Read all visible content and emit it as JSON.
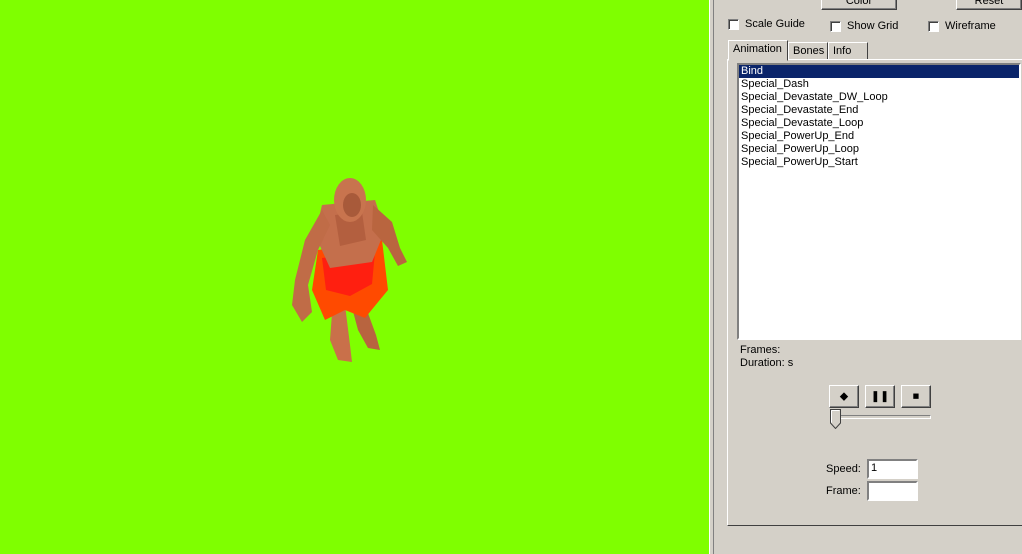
{
  "toolbar": {
    "color_button": "Color",
    "reset_button": "Reset",
    "scale_guide": "Scale Guide",
    "show_grid": "Show Grid",
    "wireframe": "Wireframe"
  },
  "tabs": [
    "Animation",
    "Bones",
    "Info"
  ],
  "animations": [
    "Bind",
    "Special_Dash",
    "Special_Devastate_DW_Loop",
    "Special_Devastate_End",
    "Special_Devastate_Loop",
    "Special_PowerUp_End",
    "Special_PowerUp_Loop",
    "Special_PowerUp_Start"
  ],
  "selected_animation": "Bind",
  "info": {
    "frames_label": "Frames:",
    "duration_label": "Duration: s"
  },
  "playback": {
    "play_icon": "play-icon",
    "pause_icon": "pause-icon",
    "stop_icon": "stop-icon",
    "position": 0
  },
  "fields": {
    "speed_label": "Speed:",
    "speed_value": "1",
    "frame_label": "Frame:",
    "frame_value": ""
  },
  "colors": {
    "viewport_bg": "#7fff00",
    "selection": "#0a246a"
  }
}
